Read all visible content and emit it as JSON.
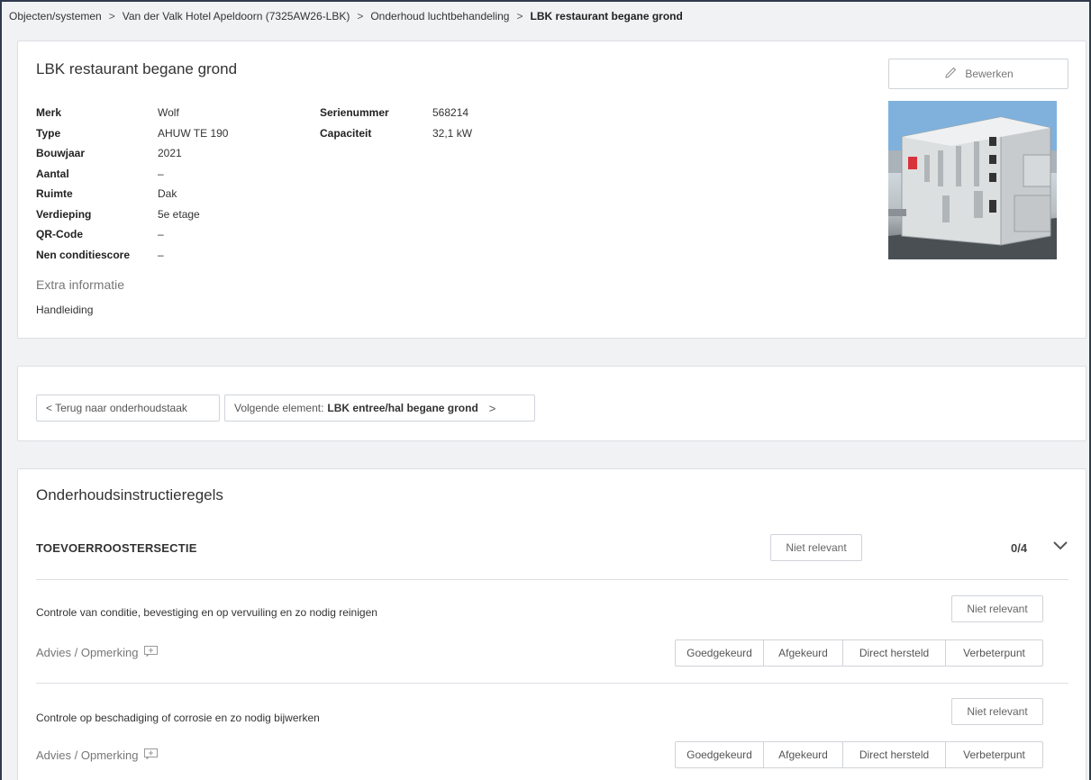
{
  "breadcrumb": {
    "items": [
      "Objecten/systemen",
      "Van der Valk Hotel Apeldoorn (7325AW26-LBK)",
      "Onderhoud luchtbehandeling"
    ],
    "current": "LBK restaurant begane grond",
    "separator": ">"
  },
  "element": {
    "title": "LBK restaurant begane grond",
    "edit_label": "Bewerken",
    "specs_left": [
      {
        "label": "Merk",
        "value": "Wolf"
      },
      {
        "label": "Type",
        "value": "AHUW TE 190"
      },
      {
        "label": "Bouwjaar",
        "value": "2021"
      },
      {
        "label": "Aantal",
        "value": "–"
      },
      {
        "label": "Ruimte",
        "value": "Dak"
      },
      {
        "label": "Verdieping",
        "value": "5e etage"
      },
      {
        "label": "QR-Code",
        "value": "–"
      },
      {
        "label": "Nen conditiescore",
        "value": "–"
      }
    ],
    "specs_right": [
      {
        "label": "Serienummer",
        "value": "568214"
      },
      {
        "label": "Capaciteit",
        "value": "32,1 kW"
      }
    ],
    "extra_heading": "Extra informatie",
    "extra_link": "Handleiding"
  },
  "navigation": {
    "back_label": "< Terug naar onderhoudstaak",
    "next_prefix": "Volgende element:",
    "next_name": "LBK entree/hal begane grond",
    "next_chevron": ">"
  },
  "rules": {
    "title": "Onderhoudsinstructieregels",
    "section": {
      "name": "TOEVOERROOSTERSECTIE",
      "not_relevant_label": "Niet relevant",
      "progress": "0/4"
    },
    "items": [
      {
        "text": "Controle van conditie, bevestiging en op vervuiling en zo nodig reinigen",
        "not_relevant_label": "Niet relevant",
        "advies_label": "Advies / Opmerking",
        "options": [
          "Goedgekeurd",
          "Afgekeurd",
          "Direct hersteld",
          "Verbeterpunt"
        ]
      },
      {
        "text": "Controle op beschadiging of corrosie en zo nodig bijwerken",
        "not_relevant_label": "Niet relevant",
        "advies_label": "Advies / Opmerking",
        "options": [
          "Goedgekeurd",
          "Afgekeurd",
          "Direct hersteld",
          "Verbeterpunt"
        ]
      }
    ]
  },
  "colors": {
    "background": "#f1f2f3",
    "card_border": "#dcdfe3",
    "frame": "#2f3b4d"
  }
}
